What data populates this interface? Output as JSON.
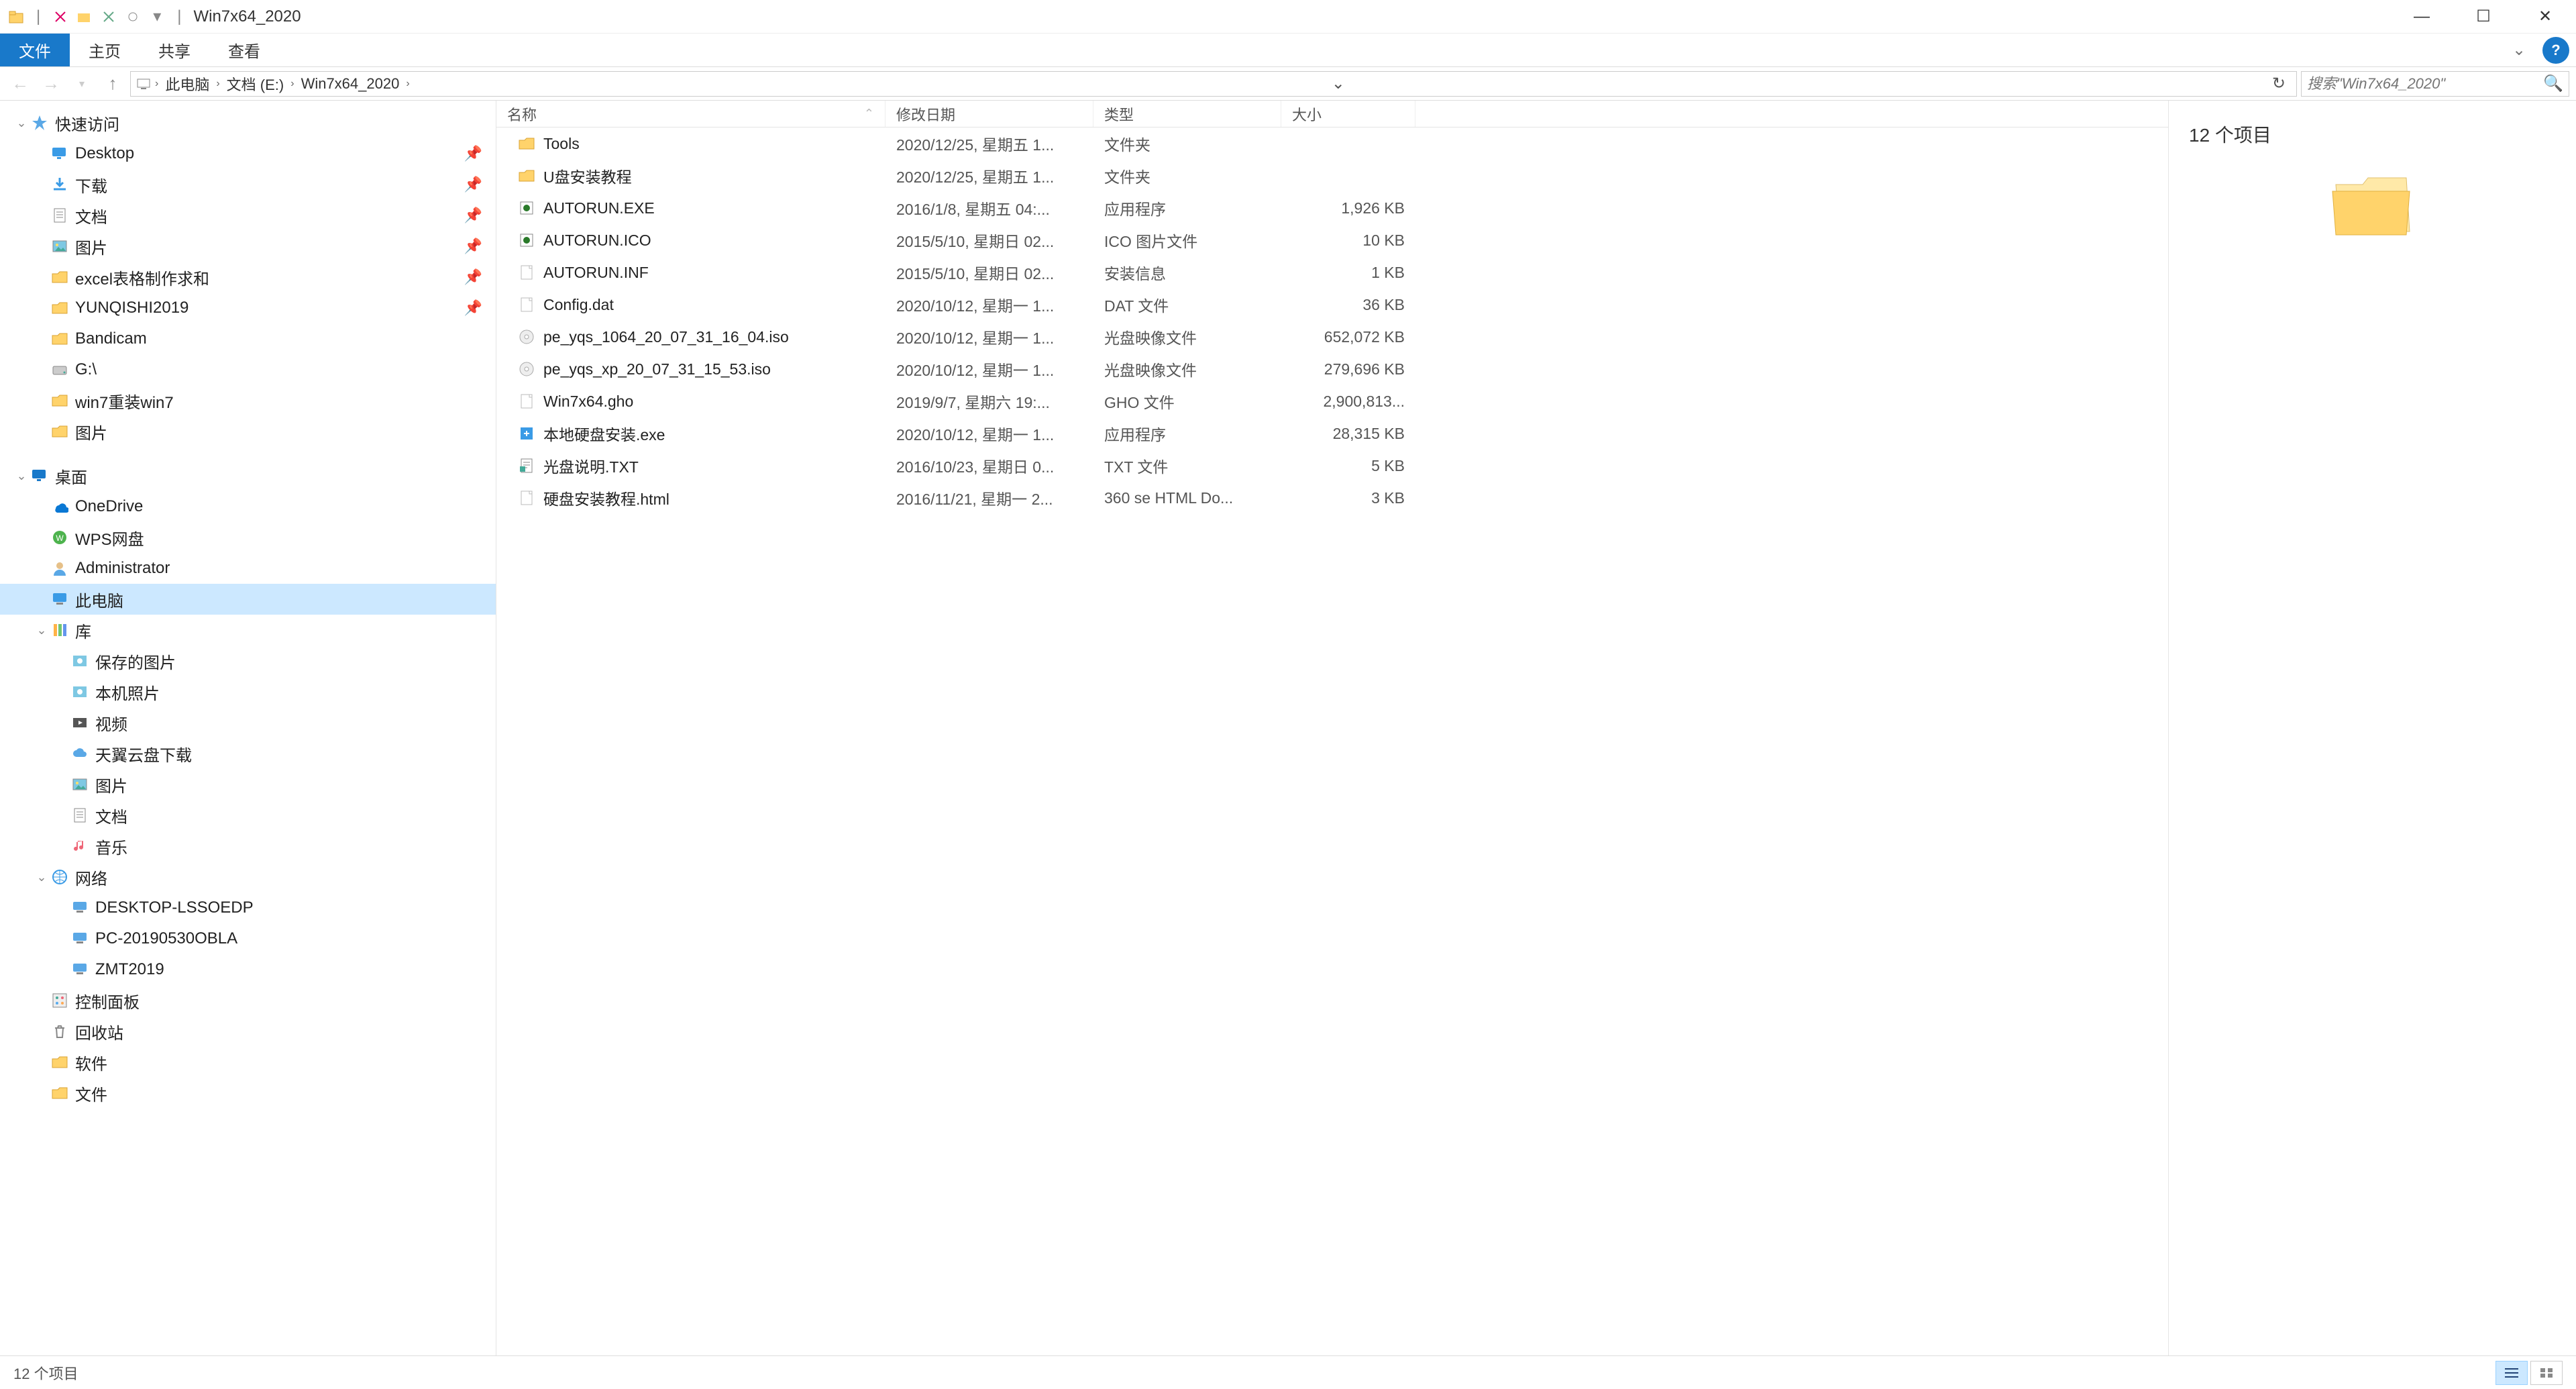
{
  "title": "Win7x64_2020",
  "ribbon": {
    "file": "文件",
    "home": "主页",
    "share": "共享",
    "view": "查看"
  },
  "breadcrumbs": [
    "此电脑",
    "文档 (E:)",
    "Win7x64_2020"
  ],
  "search_placeholder": "搜索\"Win7x64_2020\"",
  "columns": {
    "name": "名称",
    "date": "修改日期",
    "type": "类型",
    "size": "大小"
  },
  "sidebar": [
    {
      "indent": 1,
      "icon": "star",
      "label": "快速访问",
      "exp": "v"
    },
    {
      "indent": 2,
      "icon": "desktop",
      "label": "Desktop",
      "pin": true
    },
    {
      "indent": 2,
      "icon": "download",
      "label": "下载",
      "pin": true
    },
    {
      "indent": 2,
      "icon": "docs",
      "label": "文档",
      "pin": true
    },
    {
      "indent": 2,
      "icon": "pics",
      "label": "图片",
      "pin": true
    },
    {
      "indent": 2,
      "icon": "folder",
      "label": "excel表格制作求和",
      "pin": true
    },
    {
      "indent": 2,
      "icon": "folder",
      "label": "YUNQISHI2019",
      "pin": true
    },
    {
      "indent": 2,
      "icon": "folder",
      "label": "Bandicam"
    },
    {
      "indent": 2,
      "icon": "drive",
      "label": "G:\\"
    },
    {
      "indent": 2,
      "icon": "folder",
      "label": "win7重装win7"
    },
    {
      "indent": 2,
      "icon": "folder",
      "label": "图片"
    },
    {
      "spacer": true
    },
    {
      "indent": 1,
      "icon": "desktop-b",
      "label": "桌面",
      "exp": "v"
    },
    {
      "indent": 2,
      "icon": "onedrive",
      "label": "OneDrive"
    },
    {
      "indent": 2,
      "icon": "wps",
      "label": "WPS网盘"
    },
    {
      "indent": 2,
      "icon": "user",
      "label": "Administrator"
    },
    {
      "indent": 2,
      "icon": "pc",
      "label": "此电脑",
      "selected": true
    },
    {
      "indent": 2,
      "icon": "lib",
      "label": "库",
      "exp": "v"
    },
    {
      "indent": 3,
      "icon": "savedpics",
      "label": "保存的图片"
    },
    {
      "indent": 3,
      "icon": "camroll",
      "label": "本机照片"
    },
    {
      "indent": 3,
      "icon": "video",
      "label": "视频"
    },
    {
      "indent": 3,
      "icon": "cloud",
      "label": "天翼云盘下载"
    },
    {
      "indent": 3,
      "icon": "pics",
      "label": "图片"
    },
    {
      "indent": 3,
      "icon": "docs",
      "label": "文档"
    },
    {
      "indent": 3,
      "icon": "music",
      "label": "音乐"
    },
    {
      "indent": 2,
      "icon": "network",
      "label": "网络",
      "exp": "v"
    },
    {
      "indent": 3,
      "icon": "netpc",
      "label": "DESKTOP-LSSOEDP"
    },
    {
      "indent": 3,
      "icon": "netpc",
      "label": "PC-20190530OBLA"
    },
    {
      "indent": 3,
      "icon": "netpc",
      "label": "ZMT2019"
    },
    {
      "indent": 2,
      "icon": "cpanel",
      "label": "控制面板"
    },
    {
      "indent": 2,
      "icon": "recycle",
      "label": "回收站"
    },
    {
      "indent": 2,
      "icon": "folder",
      "label": "软件"
    },
    {
      "indent": 2,
      "icon": "folder",
      "label": "文件"
    }
  ],
  "files": [
    {
      "icon": "folder",
      "name": "Tools",
      "date": "2020/12/25, 星期五 1...",
      "type": "文件夹",
      "size": ""
    },
    {
      "icon": "folder",
      "name": "U盘安装教程",
      "date": "2020/12/25, 星期五 1...",
      "type": "文件夹",
      "size": ""
    },
    {
      "icon": "exe-a",
      "name": "AUTORUN.EXE",
      "date": "2016/1/8, 星期五 04:...",
      "type": "应用程序",
      "size": "1,926 KB"
    },
    {
      "icon": "ico",
      "name": "AUTORUN.ICO",
      "date": "2015/5/10, 星期日 02...",
      "type": "ICO 图片文件",
      "size": "10 KB"
    },
    {
      "icon": "inf",
      "name": "AUTORUN.INF",
      "date": "2015/5/10, 星期日 02...",
      "type": "安装信息",
      "size": "1 KB"
    },
    {
      "icon": "dat",
      "name": "Config.dat",
      "date": "2020/10/12, 星期一 1...",
      "type": "DAT 文件",
      "size": "36 KB"
    },
    {
      "icon": "iso",
      "name": "pe_yqs_1064_20_07_31_16_04.iso",
      "date": "2020/10/12, 星期一 1...",
      "type": "光盘映像文件",
      "size": "652,072 KB"
    },
    {
      "icon": "iso",
      "name": "pe_yqs_xp_20_07_31_15_53.iso",
      "date": "2020/10/12, 星期一 1...",
      "type": "光盘映像文件",
      "size": "279,696 KB"
    },
    {
      "icon": "gho",
      "name": "Win7x64.gho",
      "date": "2019/9/7, 星期六 19:...",
      "type": "GHO 文件",
      "size": "2,900,813..."
    },
    {
      "icon": "exe-b",
      "name": "本地硬盘安装.exe",
      "date": "2020/10/12, 星期一 1...",
      "type": "应用程序",
      "size": "28,315 KB"
    },
    {
      "icon": "txt",
      "name": "光盘说明.TXT",
      "date": "2016/10/23, 星期日 0...",
      "type": "TXT 文件",
      "size": "5 KB"
    },
    {
      "icon": "html",
      "name": "硬盘安装教程.html",
      "date": "2016/11/21, 星期一 2...",
      "type": "360 se HTML Do...",
      "size": "3 KB"
    }
  ],
  "preview_title": "12 个项目",
  "status": "12 个项目"
}
